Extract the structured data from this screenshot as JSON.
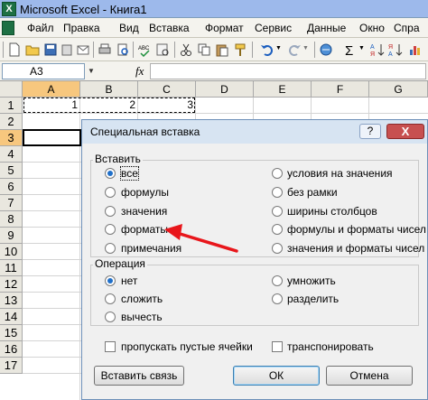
{
  "window": {
    "title": "Microsoft Excel - Книга1",
    "app_icon_letter": "X"
  },
  "menu": {
    "items": [
      "Файл",
      "Правка",
      "Вид",
      "Вставка",
      "Формат",
      "Сервис",
      "Данные",
      "Окно",
      "Спра"
    ]
  },
  "formula_bar": {
    "name_box": "A3",
    "fx": "fx"
  },
  "sheet": {
    "columns": [
      "A",
      "B",
      "C",
      "D",
      "E",
      "F",
      "G"
    ],
    "rows": [
      "1",
      "2",
      "3",
      "4",
      "5",
      "6",
      "7",
      "8",
      "9",
      "10",
      "11",
      "12",
      "13",
      "14",
      "15",
      "16",
      "17"
    ],
    "cells": {
      "A1": "1",
      "B1": "2",
      "C1": "3"
    }
  },
  "dialog": {
    "title": "Специальная вставка",
    "help": "?",
    "close": "X",
    "paste_group": {
      "label": "Вставить",
      "left_options": [
        "все",
        "формулы",
        "значения",
        "форматы",
        "примечания"
      ],
      "right_options": [
        "условия на значения",
        "без рамки",
        "ширины столбцов",
        "формулы и форматы чисел",
        "значения и форматы чисел"
      ],
      "selected": "все"
    },
    "operation_group": {
      "label": "Операция",
      "left_options": [
        "нет",
        "сложить",
        "вычесть"
      ],
      "right_options": [
        "умножить",
        "разделить"
      ],
      "selected": "нет"
    },
    "skip_blanks": "пропускать пустые ячейки",
    "transpose": "транспонировать",
    "paste_link_button": "Вставить связь",
    "ok_button": "ОК",
    "cancel_button": "Отмена"
  },
  "annotation": {
    "arrow_color": "#e8161b"
  }
}
